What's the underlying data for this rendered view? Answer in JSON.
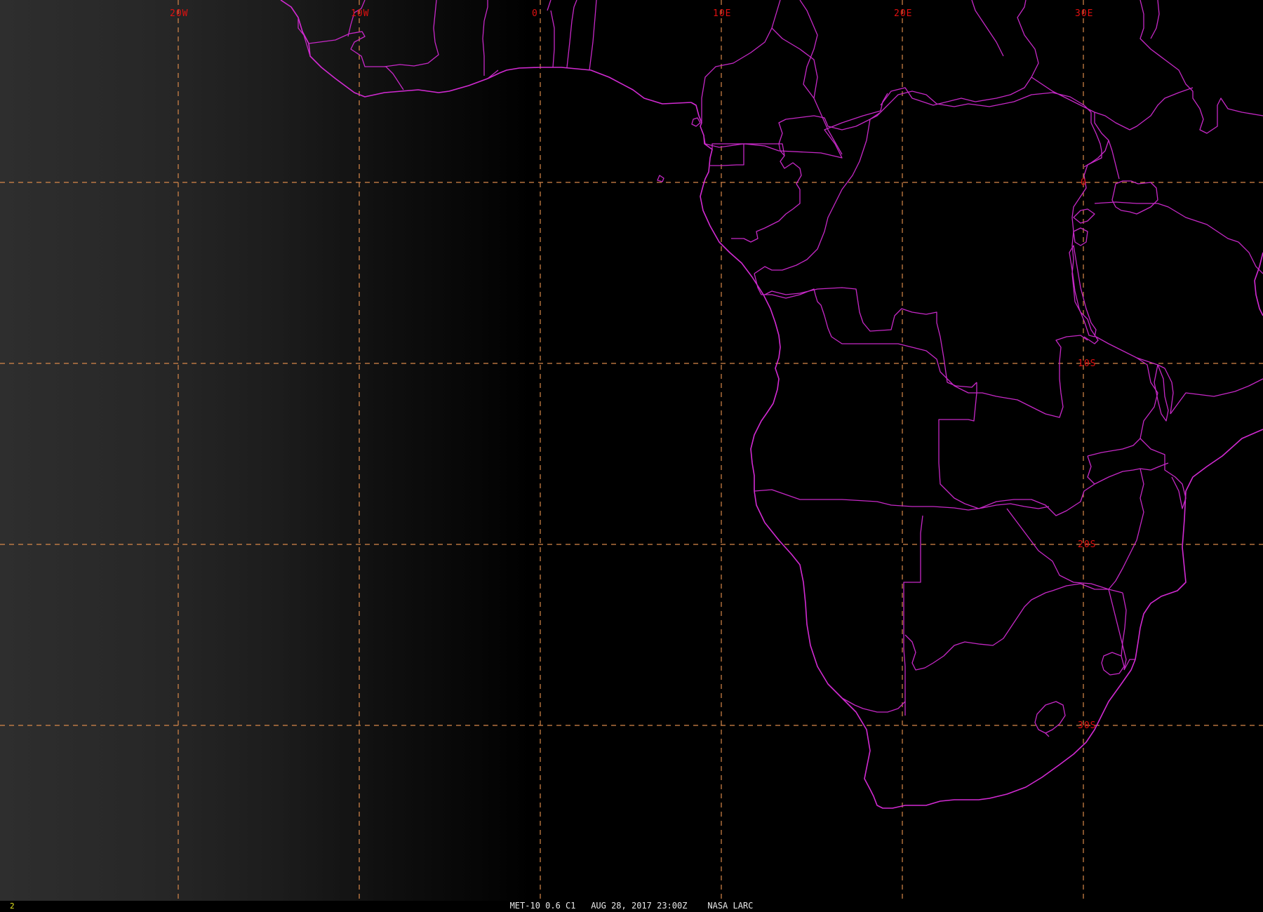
{
  "viewer": {
    "frame_number": "2",
    "caption": {
      "satellite": "MET-10 0.6 C1",
      "datetime": "AUG 28, 2017 23:00Z",
      "credit": "NASA LARC"
    }
  },
  "grid": {
    "longitude_labels": [
      {
        "lon": -20,
        "text": "20W"
      },
      {
        "lon": -10,
        "text": "10W"
      },
      {
        "lon": 0,
        "text": "0"
      },
      {
        "lon": 10,
        "text": "10E"
      },
      {
        "lon": 20,
        "text": "20E"
      },
      {
        "lon": 30,
        "text": "30E"
      }
    ],
    "latitude_labels": [
      {
        "lat": 0,
        "text": "0"
      },
      {
        "lat": -10,
        "text": "10S"
      },
      {
        "lat": -20,
        "text": "20S"
      },
      {
        "lat": -30,
        "text": "30S"
      }
    ]
  },
  "colors": {
    "background": "#000000",
    "boundaries": "#d22ad2",
    "grid_lines": "#d8884a",
    "grid_labels": "#e01010",
    "frame_number": "#e8e820",
    "caption": "#e8e8e8"
  }
}
